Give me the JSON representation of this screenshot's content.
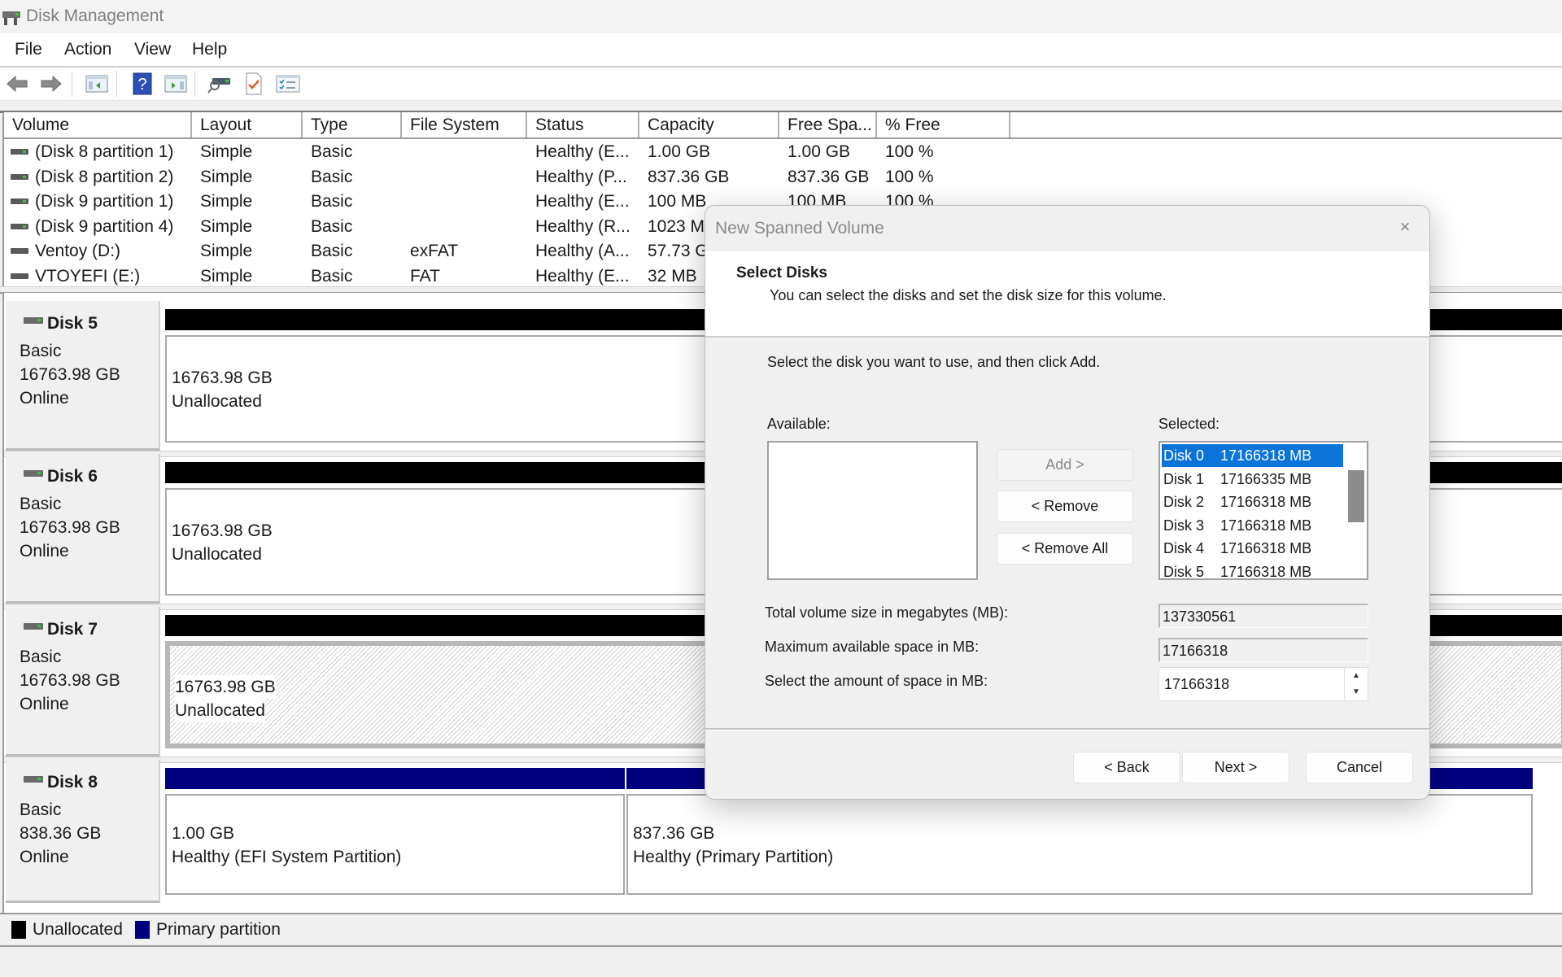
{
  "window": {
    "title": "Disk Management"
  },
  "menu": [
    "File",
    "Action",
    "View",
    "Help"
  ],
  "toolbar": {
    "buttons": [
      {
        "icon": "back-arrow-icon",
        "label": "Back"
      },
      {
        "icon": "forward-arrow-icon",
        "label": "Forward"
      },
      {
        "icon": "show-hide-console-tree-icon",
        "label": "Show/Hide Console Tree"
      },
      {
        "icon": "help-icon",
        "label": "Help"
      },
      {
        "icon": "show-hide-action-pane-icon",
        "label": "Show/Hide Action Pane"
      },
      {
        "icon": "connect-virtual-disk-icon",
        "label": "Connect"
      },
      {
        "icon": "properties-checklist-icon",
        "label": "Properties"
      },
      {
        "icon": "settings-list-icon",
        "label": "Settings"
      }
    ]
  },
  "volume_table": {
    "columns": [
      "Volume",
      "Layout",
      "Type",
      "File System",
      "Status",
      "Capacity",
      "Free Spa...",
      "% Free"
    ],
    "rows": [
      {
        "volume": "(Disk 8 partition 1)",
        "layout": "Simple",
        "type": "Basic",
        "fs": "",
        "status": "Healthy (E...",
        "capacity": "1.00 GB",
        "free": "1.00 GB",
        "pct": "100 %"
      },
      {
        "volume": "(Disk 8 partition 2)",
        "layout": "Simple",
        "type": "Basic",
        "fs": "",
        "status": "Healthy (P...",
        "capacity": "837.36 GB",
        "free": "837.36 GB",
        "pct": "100 %"
      },
      {
        "volume": "(Disk 9 partition 1)",
        "layout": "Simple",
        "type": "Basic",
        "fs": "",
        "status": "Healthy (E...",
        "capacity": "100 MB",
        "free": "100 MB",
        "pct": "100 %"
      },
      {
        "volume": "(Disk 9 partition 4)",
        "layout": "Simple",
        "type": "Basic",
        "fs": "",
        "status": "Healthy (R...",
        "capacity": "1023 M",
        "free": "",
        "pct": ""
      },
      {
        "volume": "Ventoy (D:)",
        "layout": "Simple",
        "type": "Basic",
        "fs": "exFAT",
        "status": "Healthy (A...",
        "capacity": "57.73 G",
        "free": "",
        "pct": ""
      },
      {
        "volume": "VTOYEFI (E:)",
        "layout": "Simple",
        "type": "Basic",
        "fs": "FAT",
        "status": "Healthy (E...",
        "capacity": "32 MB",
        "free": "",
        "pct": ""
      }
    ]
  },
  "disks": [
    {
      "name": "Disk 5",
      "type": "Basic",
      "size": "16763.98 GB",
      "state": "Online",
      "partitions": [
        {
          "size": "16763.98 GB",
          "status": "Unallocated",
          "kind": "unallocated"
        }
      ]
    },
    {
      "name": "Disk 6",
      "type": "Basic",
      "size": "16763.98 GB",
      "state": "Online",
      "partitions": [
        {
          "size": "16763.98 GB",
          "status": "Unallocated",
          "kind": "unallocated"
        }
      ]
    },
    {
      "name": "Disk 7",
      "type": "Basic",
      "size": "16763.98 GB",
      "state": "Online",
      "partitions": [
        {
          "size": "16763.98 GB",
          "status": "Unallocated",
          "kind": "unallocated",
          "selected": true
        }
      ]
    },
    {
      "name": "Disk 8",
      "type": "Basic",
      "size": "838.36 GB",
      "state": "Online",
      "partitions": [
        {
          "size": "1.00 GB",
          "status": "Healthy (EFI System Partition)",
          "kind": "primary"
        },
        {
          "size": "837.36 GB",
          "status": "Healthy (Primary Partition)",
          "kind": "primary"
        }
      ]
    }
  ],
  "legend": [
    {
      "label": "Unallocated",
      "color": "#000000"
    },
    {
      "label": "Primary partition",
      "color": "#00007f"
    }
  ],
  "colors": {
    "unallocated": "#000000",
    "primary": "#00007f",
    "selection": "#0a74d8"
  },
  "dialog": {
    "title": "New Spanned Volume",
    "close_label": "×",
    "heading": "Select Disks",
    "subheading": "You can select the disks and set the disk size for this volume.",
    "instruction": "Select the disk you want to use, and then click Add.",
    "available_label": "Available:",
    "available_items": [],
    "selected_label": "Selected:",
    "selected_items": [
      {
        "disk": "Disk 0",
        "size": "17166318 MB",
        "selected": true
      },
      {
        "disk": "Disk 1",
        "size": "17166335 MB"
      },
      {
        "disk": "Disk 2",
        "size": "17166318 MB"
      },
      {
        "disk": "Disk 3",
        "size": "17166318 MB"
      },
      {
        "disk": "Disk 4",
        "size": "17166318 MB"
      },
      {
        "disk": "Disk 5",
        "size": "17166318 MB"
      }
    ],
    "add_label": "Add >",
    "remove_label": "< Remove",
    "remove_all_label": "< Remove All",
    "total_size_label": "Total volume size in megabytes (MB):",
    "total_size_value": "137330561",
    "max_space_label": "Maximum available space in MB:",
    "max_space_value": "17166318",
    "amount_label": "Select the amount of space in MB:",
    "amount_value": "17166318",
    "back_label": "< Back",
    "next_label": "Next >",
    "cancel_label": "Cancel"
  }
}
